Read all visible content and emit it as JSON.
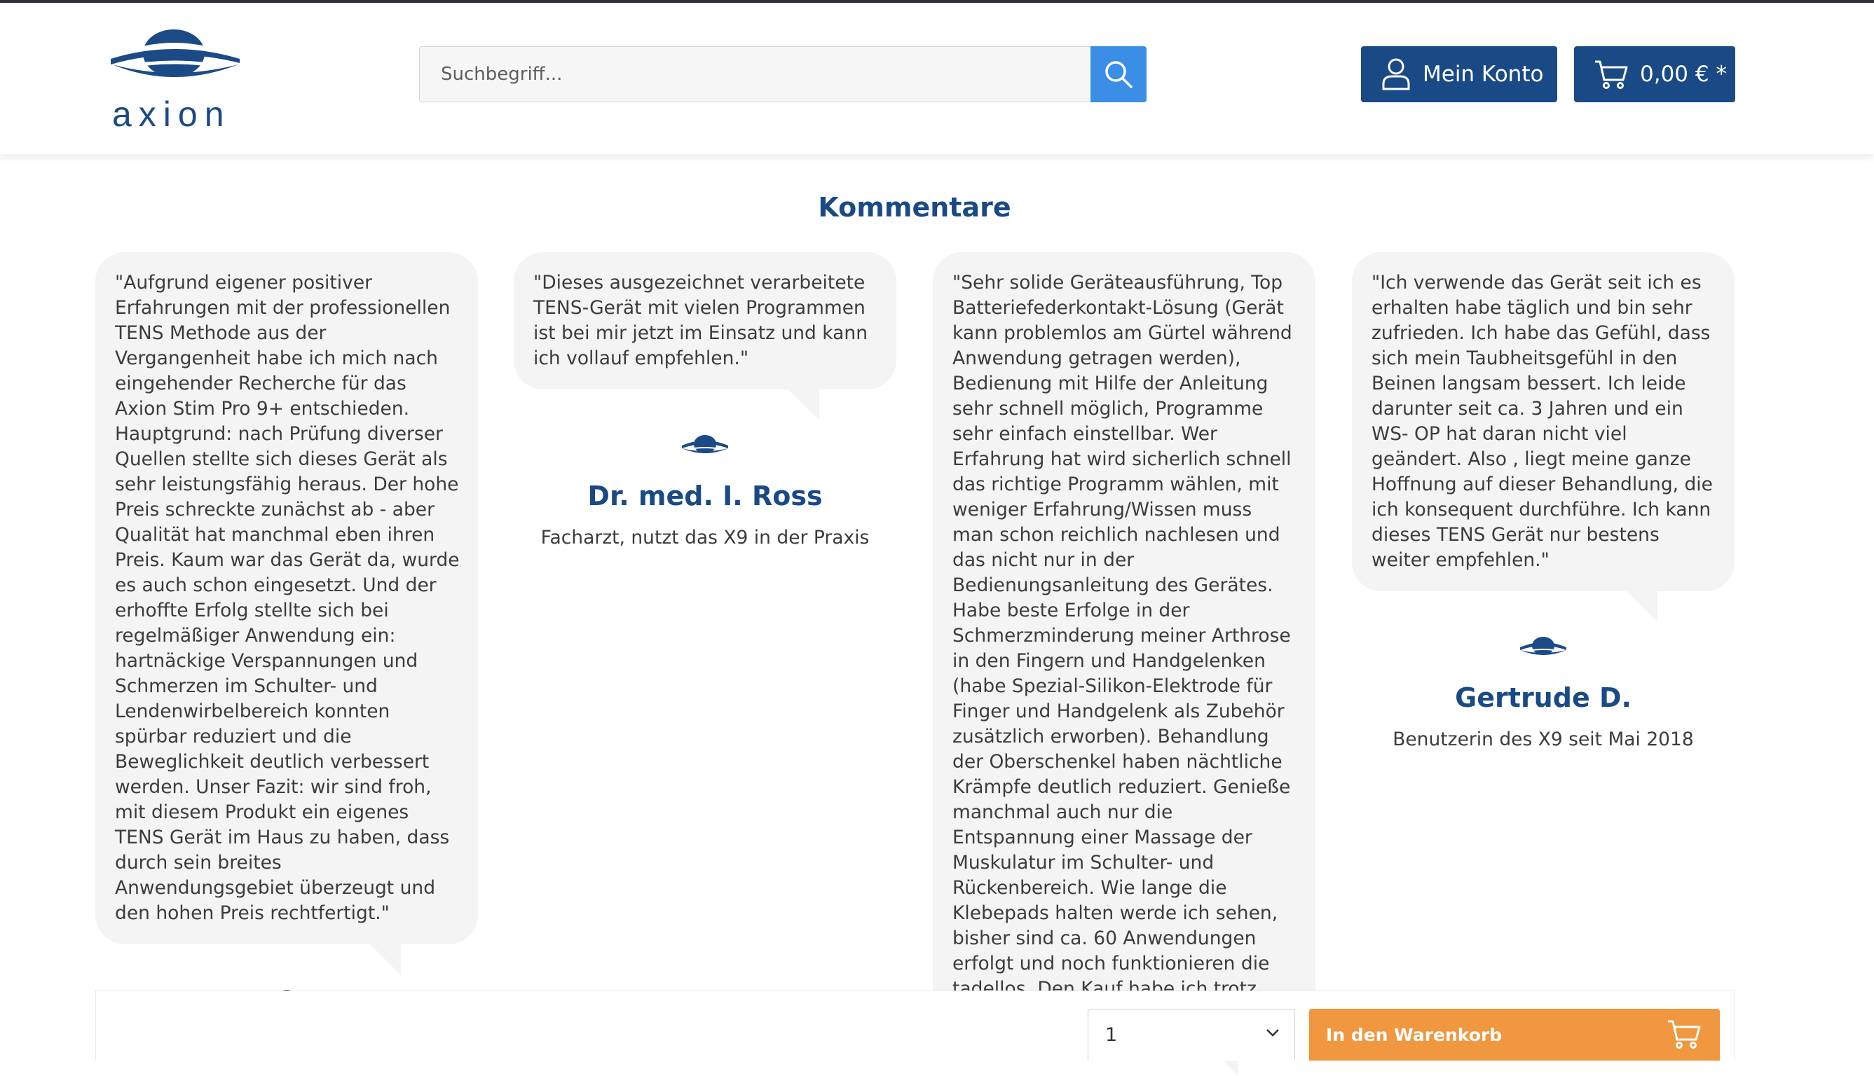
{
  "header": {
    "logo_text": "axion",
    "search_placeholder": "Suchbegriff...",
    "account_label": "Mein Konto",
    "cart_total": "0,00 € *"
  },
  "section_title": "Kommentare",
  "testimonials": [
    {
      "text": "\"Aufgrund eigener positiver Erfahrungen mit der professionellen TENS Methode aus der Vergangenheit habe ich mich nach eingehender Recherche für das Axion Stim Pro 9+ entschieden. Hauptgrund: nach Prüfung diverser Quellen stellte sich dieses Gerät als sehr leistungsfähig heraus. Der hohe Preis schreckte zunächst ab - aber Qualität hat manchmal eben ihren Preis. Kaum war das Gerät da, wurde es auch schon eingesetzt. Und der erhoffte Erfolg stellte sich bei regelmäßiger Anwendung ein: hartnäckige Verspannungen und Schmerzen im Schulter- und Lendenwirbelbereich konnten spürbar reduziert und die Beweglichkeit deutlich verbessert werden. Unser Fazit: wir sind froh, mit diesem Produkt ein eigenes TENS Gerät im Haus zu haben, dass durch sein breites Anwendungsgebiet überzeugt und den hohen Preis rechtfertigt.\"",
      "author": "",
      "role": ""
    },
    {
      "text": "\"Dieses ausgezeichnet verarbeitete TENS-Gerät mit vielen Programmen ist bei mir jetzt im Einsatz und kann ich vollauf empfehlen.\"",
      "author": "Dr. med. I. Ross",
      "role": "Facharzt, nutzt das X9 in der Praxis"
    },
    {
      "text": "\"Sehr solide Geräteausführung, Top Batteriefederkontakt-Lösung (Gerät kann problemlos am Gürtel während Anwendung getragen werden), Bedienung mit Hilfe der Anleitung sehr schnell möglich, Programme sehr einfach einstellbar. Wer Erfahrung hat wird sicherlich schnell das richtige Programm wählen, mit weniger Erfahrung/Wissen muss man schon reichlich nachlesen und das nicht nur in der Bedienungsanleitung des Gerätes. Habe beste Erfolge in der Schmerzminderung meiner Arthrose in den Fingern und Handgelenken (habe Spezial-Silikon-Elektrode für Finger und Handgelenk als Zubehör zusätzlich erworben). Behandlung der Oberschenkel haben nächtliche Krämpfe deutlich reduziert. Genieße manchmal auch nur die Entspannung einer Massage der Muskulatur im Schulter- und Rückenbereich. Wie lange die Klebepads halten werde ich sehen, bisher sind ca. 60 Anwendungen erfolgt und noch funktionieren die tadellos. Den Kauf habe ich trotz höherer Preisklasse",
      "author": "",
      "role": ""
    },
    {
      "text": "\"Ich verwende das Gerät seit ich es erhalten habe täglich und bin sehr zufrieden. Ich habe das Gefühl, dass sich mein Taubheitsgefühl in den Beinen langsam bessert. Ich leide darunter seit ca. 3 Jahren und ein WS- OP hat daran nicht viel geändert. Also , liegt meine ganze Hoffnung auf dieser Behandlung, die ich konsequent durchführe. Ich kann dieses TENS Gerät nur bestens weiter empfehlen.\"",
      "author": "Gertrude D.",
      "role": "Benutzerin des X9 seit Mai 2018"
    }
  ],
  "buybar": {
    "quantity": "1",
    "add_to_cart_label": "In den Warenkorb"
  },
  "colors": {
    "brand_blue": "#1a4a85",
    "search_blue": "#3a8ee6",
    "cta_orange": "#f0973f",
    "bubble_grey": "#f4f4f4"
  }
}
